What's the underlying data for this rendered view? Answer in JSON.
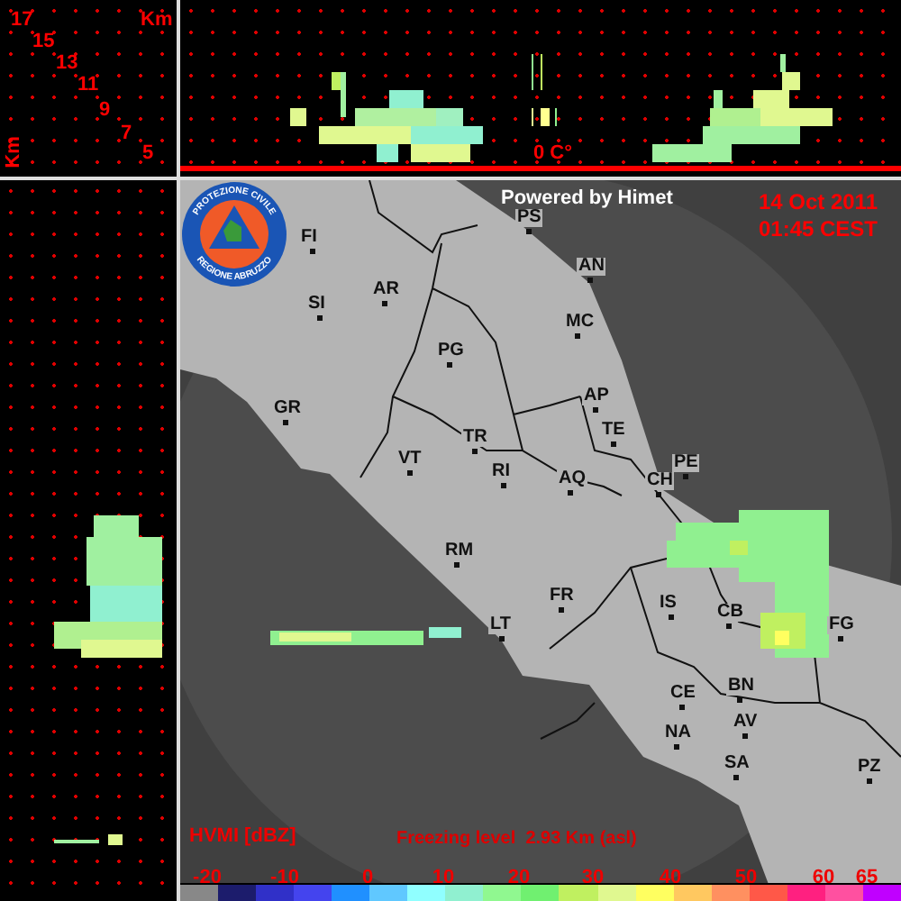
{
  "height_scale": {
    "labels": [
      "17",
      "15",
      "13",
      "11",
      "9",
      "7",
      "5"
    ],
    "unit_top": "Km",
    "unit_side": "Km"
  },
  "top_profile": {
    "freezing_marker": "0 C°"
  },
  "logo": {
    "line_1": "PROTEZIONE CIVILE",
    "line_2": "REGIONE ABRUZZO"
  },
  "header": {
    "credit": "Powered by Himet",
    "date": "14 Oct 2011",
    "time": "01:45 CEST"
  },
  "cities": [
    {
      "code": "FI"
    },
    {
      "code": "PS"
    },
    {
      "code": "AN"
    },
    {
      "code": "SI"
    },
    {
      "code": "AR"
    },
    {
      "code": "MC"
    },
    {
      "code": "PG"
    },
    {
      "code": "AP"
    },
    {
      "code": "GR"
    },
    {
      "code": "TE"
    },
    {
      "code": "TR"
    },
    {
      "code": "VT"
    },
    {
      "code": "RI"
    },
    {
      "code": "AQ"
    },
    {
      "code": "PE"
    },
    {
      "code": "CH"
    },
    {
      "code": "RM"
    },
    {
      "code": "FR"
    },
    {
      "code": "IS"
    },
    {
      "code": "CB"
    },
    {
      "code": "FG"
    },
    {
      "code": "LT"
    },
    {
      "code": "CE"
    },
    {
      "code": "BN"
    },
    {
      "code": "AV"
    },
    {
      "code": "NA"
    },
    {
      "code": "SA"
    },
    {
      "code": "PZ"
    }
  ],
  "legend": {
    "title": "HVMI [dBZ]",
    "freezing_level": "Freezing level  2.93 Km (asl)",
    "ticks": [
      "-20",
      "-10",
      "0",
      "10",
      "20",
      "30",
      "40",
      "50",
      "60",
      "65"
    ],
    "swatches": [
      {
        "color": "#888888"
      },
      {
        "color": "#1c1c6c"
      },
      {
        "color": "#3030c8"
      },
      {
        "color": "#4444ee"
      },
      {
        "color": "#2090ff"
      },
      {
        "color": "#60c8ff"
      },
      {
        "color": "#90ffff"
      },
      {
        "color": "#90f0d0"
      },
      {
        "color": "#90f890"
      },
      {
        "color": "#70f070"
      },
      {
        "color": "#c0f060"
      },
      {
        "color": "#e0f890"
      },
      {
        "color": "#ffff60"
      },
      {
        "color": "#ffc860"
      },
      {
        "color": "#ff9060"
      },
      {
        "color": "#ff5848"
      },
      {
        "color": "#ff2080"
      },
      {
        "color": "#ff50a0"
      },
      {
        "color": "#c000ff"
      }
    ]
  }
}
